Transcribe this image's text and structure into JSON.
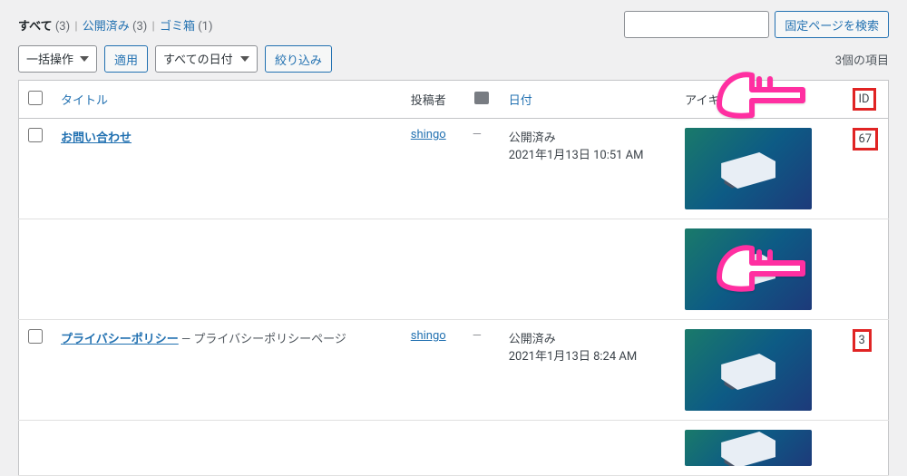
{
  "filters": {
    "all_label": "すべて",
    "all_count": "(3)",
    "published_label": "公開済み",
    "published_count": "(3)",
    "trash_label": "ゴミ箱",
    "trash_count": "(1)"
  },
  "search": {
    "placeholder": "",
    "button": "固定ページを検索"
  },
  "bulk": {
    "action_label": "一括操作",
    "apply_label": "適用",
    "date_filter_label": "すべての日付",
    "filter_button": "絞り込み"
  },
  "pagination": {
    "items_text": "3個の項目"
  },
  "columns": {
    "title": "タイトル",
    "author": "投稿者",
    "date": "日付",
    "thumbnail": "アイキャッチ",
    "id": "ID"
  },
  "rows": [
    {
      "title": "お問い合わせ",
      "subtitle": "",
      "author": "shingo",
      "comments": "—",
      "status": "公開済み",
      "date_line": "2021年1月13日 10:51 AM",
      "id": "67"
    },
    {
      "title": "プライバシーポリシー",
      "subtitle": " — プライバシーポリシーページ",
      "author": "shingo",
      "comments": "—",
      "status": "公開済み",
      "date_line": "2021年1月13日 8:24 AM",
      "id": "3"
    }
  ]
}
